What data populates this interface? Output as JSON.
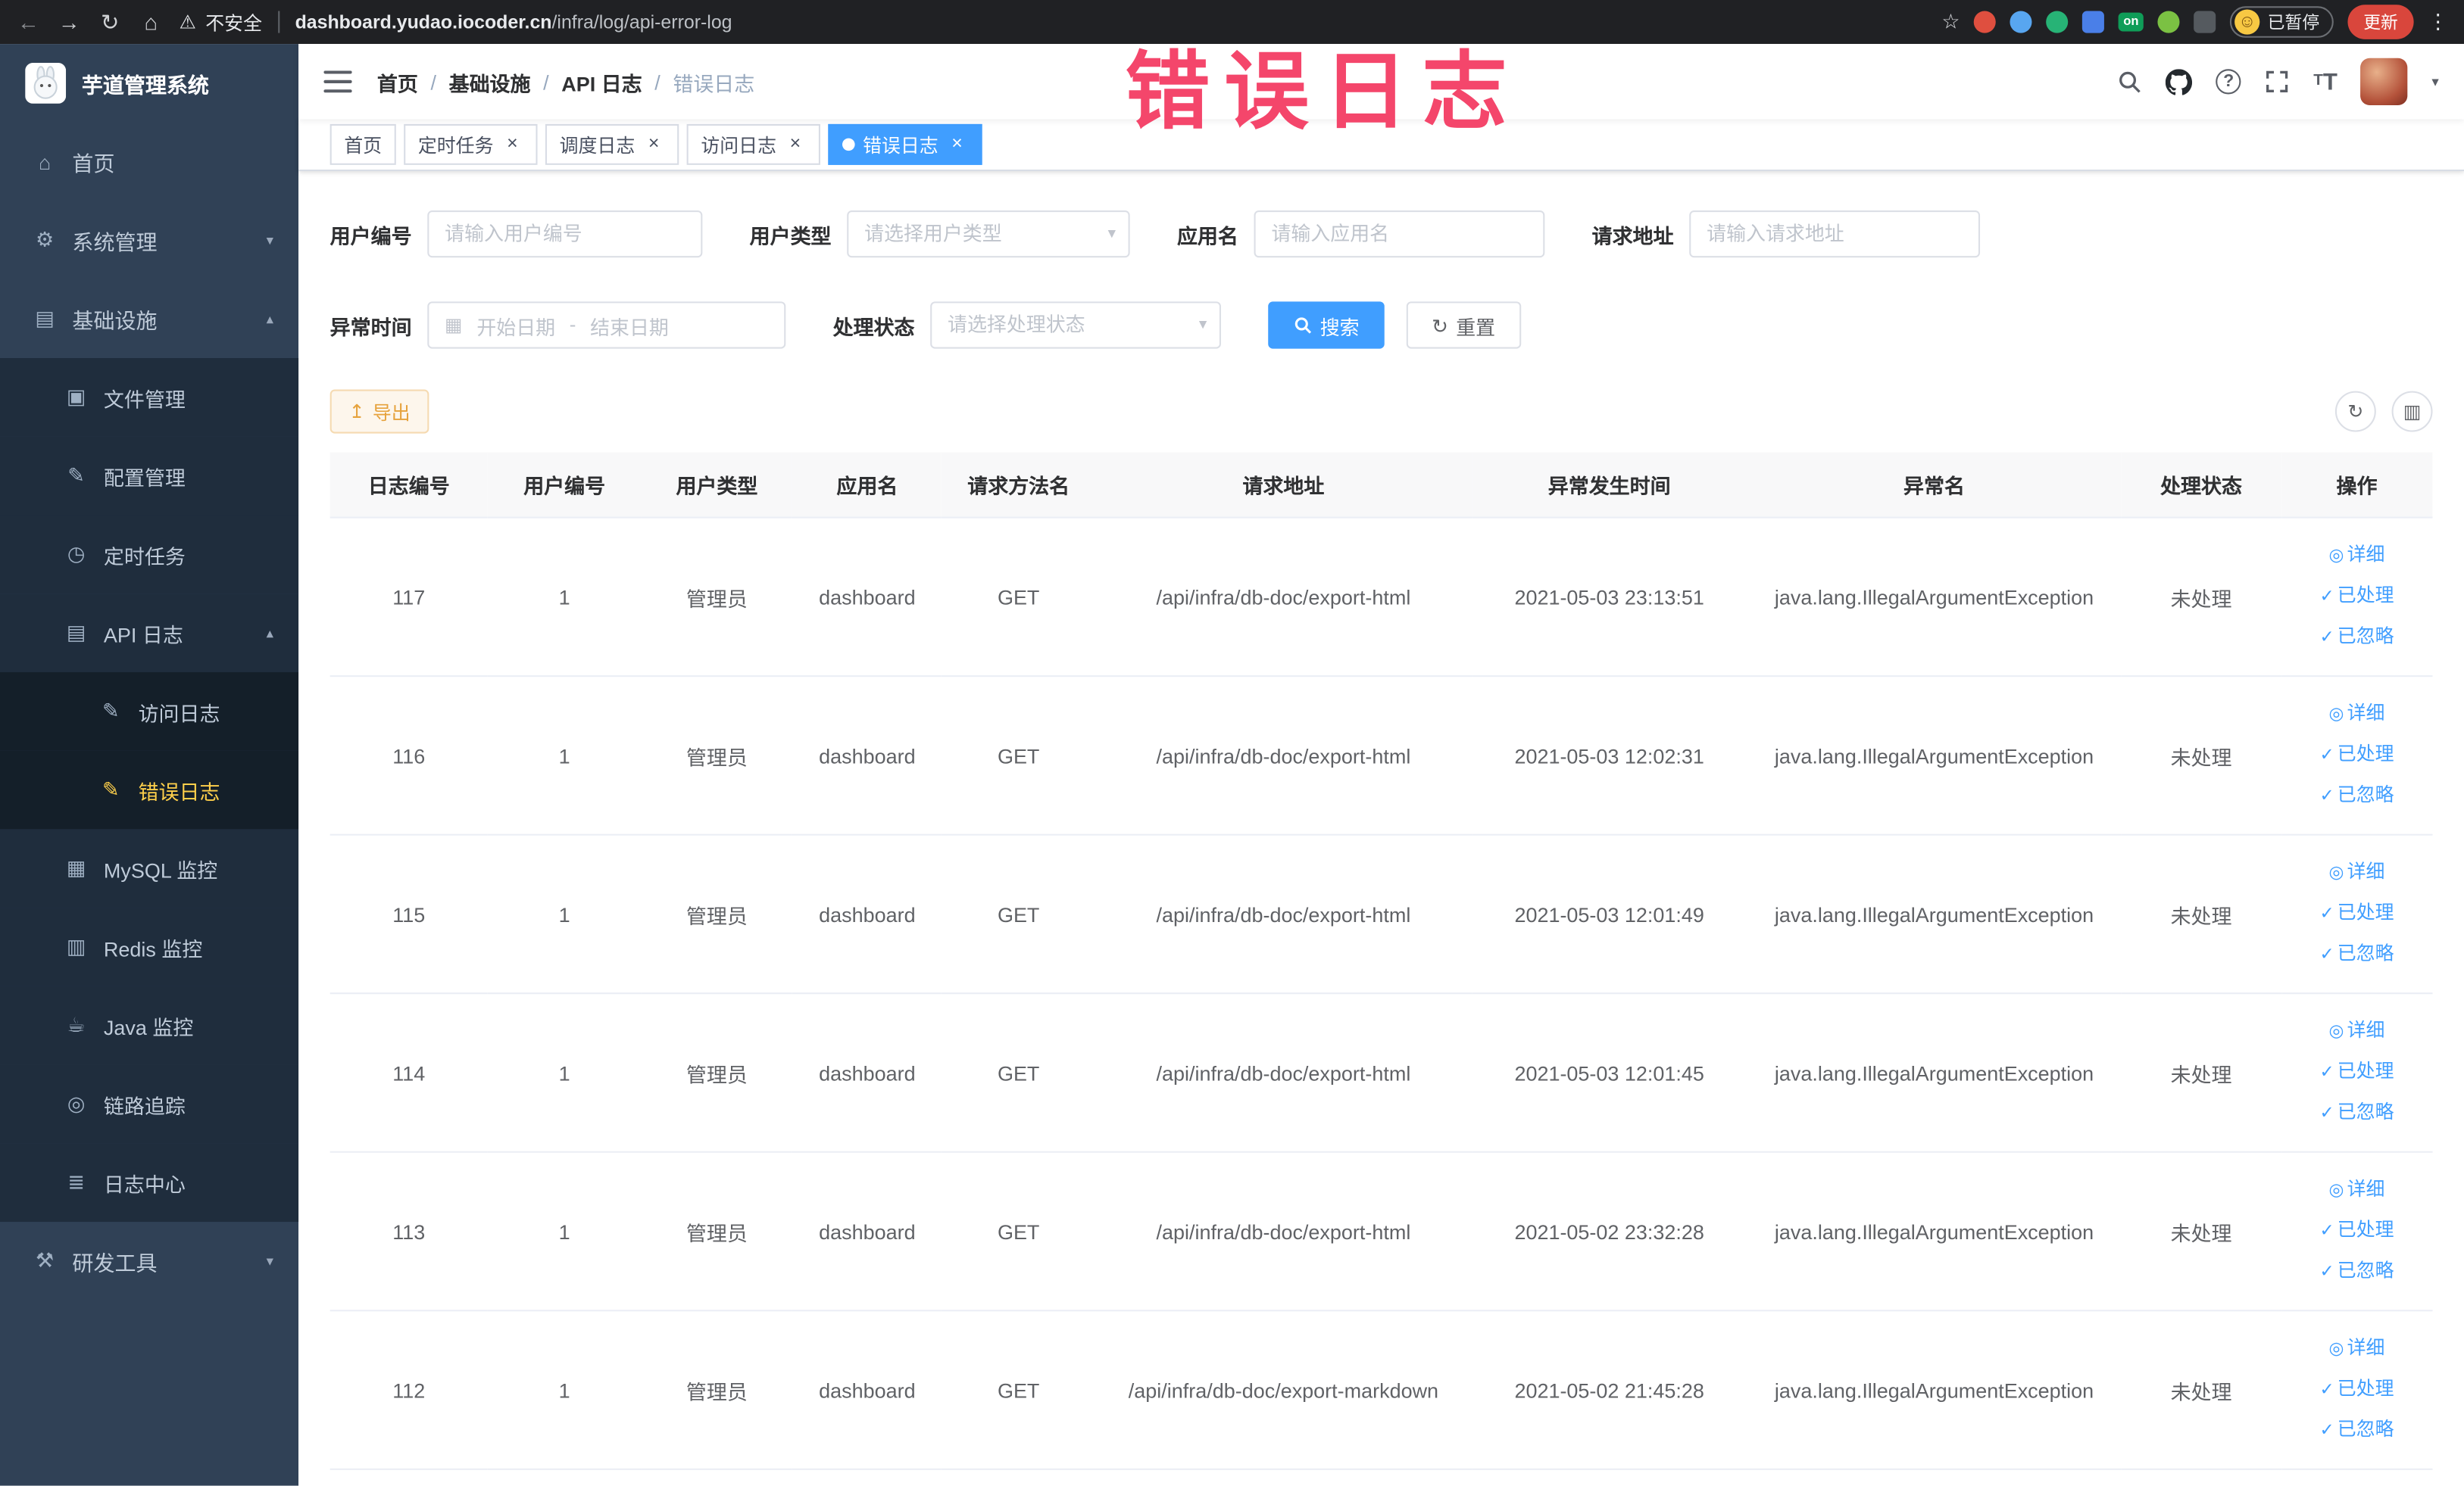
{
  "browser": {
    "security_label": "不安全",
    "url_domain": "dashboard.yudao.iocoder.cn",
    "url_path": "/infra/log/api-error-log",
    "extension_on_badge": "on",
    "paused_badge": "已暂停",
    "update_button": "更新"
  },
  "sidebar": {
    "logo_title": "芋道管理系统",
    "menu": {
      "home": "首页",
      "system": "系统管理",
      "infra": "基础设施",
      "file": "文件管理",
      "config": "配置管理",
      "job": "定时任务",
      "api_log": "API 日志",
      "access_log": "访问日志",
      "error_log": "错误日志",
      "mysql": "MySQL 监控",
      "redis": "Redis 监控",
      "java": "Java 监控",
      "trace": "链路追踪",
      "log_center": "日志中心",
      "dev_tools": "研发工具"
    }
  },
  "navbar": {
    "breadcrumb": {
      "items": [
        "首页",
        "基础设施",
        "API 日志",
        "错误日志"
      ],
      "separator": "/"
    }
  },
  "annotation": "错误日志",
  "tags": {
    "items": [
      "首页",
      "定时任务",
      "调度日志",
      "访问日志",
      "错误日志"
    ],
    "close": "×"
  },
  "filters": {
    "user_id": {
      "label": "用户编号",
      "placeholder": "请输入用户编号"
    },
    "user_type": {
      "label": "用户类型",
      "placeholder": "请选择用户类型"
    },
    "app_name": {
      "label": "应用名",
      "placeholder": "请输入应用名"
    },
    "request_url": {
      "label": "请求地址",
      "placeholder": "请输入请求地址"
    },
    "exception_time": {
      "label": "异常时间",
      "start_placeholder": "开始日期",
      "separator": "-",
      "end_placeholder": "结束日期"
    },
    "process_status": {
      "label": "处理状态",
      "placeholder": "请选择处理状态"
    },
    "search_button": "搜索",
    "reset_button": "重置"
  },
  "toolbar": {
    "export_label": "导出"
  },
  "table": {
    "columns": [
      "日志编号",
      "用户编号",
      "用户类型",
      "应用名",
      "请求方法名",
      "请求地址",
      "异常发生时间",
      "异常名",
      "处理状态",
      "操作"
    ],
    "actions": {
      "detail": "详细",
      "processed": "已处理",
      "ignored": "已忽略"
    },
    "rows": [
      {
        "id": "117",
        "user_id": "1",
        "user_type": "管理员",
        "app": "dashboard",
        "method": "GET",
        "url": "/api/infra/db-doc/export-html",
        "time": "2021-05-03 23:13:51",
        "exception": "java.lang.IllegalArgumentException",
        "status": "未处理"
      },
      {
        "id": "116",
        "user_id": "1",
        "user_type": "管理员",
        "app": "dashboard",
        "method": "GET",
        "url": "/api/infra/db-doc/export-html",
        "time": "2021-05-03 12:02:31",
        "exception": "java.lang.IllegalArgumentException",
        "status": "未处理"
      },
      {
        "id": "115",
        "user_id": "1",
        "user_type": "管理员",
        "app": "dashboard",
        "method": "GET",
        "url": "/api/infra/db-doc/export-html",
        "time": "2021-05-03 12:01:49",
        "exception": "java.lang.IllegalArgumentException",
        "status": "未处理"
      },
      {
        "id": "114",
        "user_id": "1",
        "user_type": "管理员",
        "app": "dashboard",
        "method": "GET",
        "url": "/api/infra/db-doc/export-html",
        "time": "2021-05-03 12:01:45",
        "exception": "java.lang.IllegalArgumentException",
        "status": "未处理"
      },
      {
        "id": "113",
        "user_id": "1",
        "user_type": "管理员",
        "app": "dashboard",
        "method": "GET",
        "url": "/api/infra/db-doc/export-html",
        "time": "2021-05-02 23:32:28",
        "exception": "java.lang.IllegalArgumentException",
        "status": "未处理"
      },
      {
        "id": "112",
        "user_id": "1",
        "user_type": "管理员",
        "app": "dashboard",
        "method": "GET",
        "url": "/api/infra/db-doc/export-markdown",
        "time": "2021-05-02 21:45:28",
        "exception": "java.lang.IllegalArgumentException",
        "status": "未处理"
      }
    ]
  },
  "icons": {
    "nav_back": "←",
    "nav_forward": "→",
    "nav_reload": "↻",
    "nav_home": "⌂",
    "warning": "⚠",
    "star": "☆",
    "menu_dots": "⋮",
    "smile": "☺",
    "home": "⌂",
    "gear": "⚙",
    "infra": "▤",
    "file": "▣",
    "config": "✎",
    "clock": "◷",
    "doc": "▤",
    "mysql": "▦",
    "redis": "▥",
    "java": "☕",
    "trace": "◎",
    "log_center": "≣",
    "tools": "⚒",
    "caret_down": "▾",
    "caret_up": "▴",
    "calendar": "▦",
    "refresh": "↻",
    "export": "↥",
    "view": "◎",
    "check": "✓",
    "columns": "▥",
    "question": "?"
  }
}
